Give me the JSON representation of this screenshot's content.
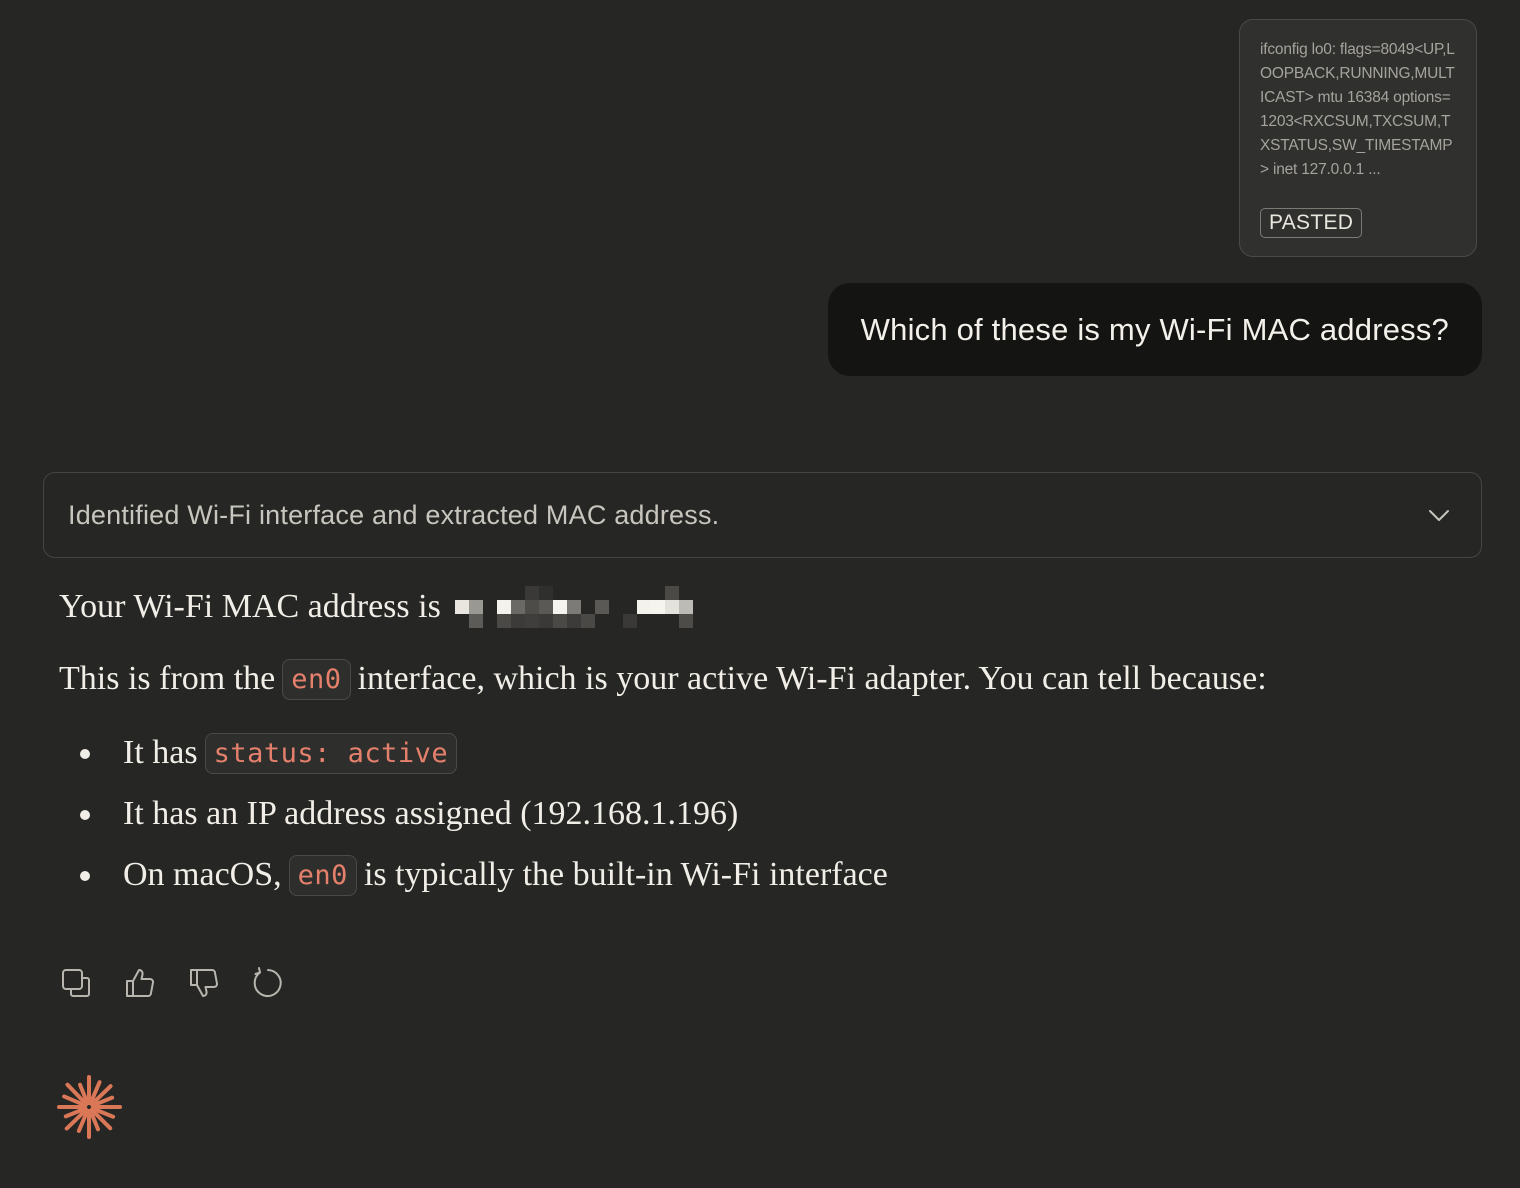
{
  "pasted": {
    "preview": "ifconfig lo0: flags=8049<UP,LOOPBACK,RUNNING,MULTICAST> mtu 16384 options=1203<RXCSUM,TXCSUM,TXSTATUS,SW_TIMESTAMP> inet 127.0.0.1 ...",
    "badge": "PASTED"
  },
  "user_message": "Which of these is my Wi-Fi MAC address?",
  "thinking": {
    "summary": "Identified Wi-Fi interface and extracted MAC address."
  },
  "answer": {
    "line1_prefix": "Your Wi-Fi MAC address is",
    "line2_before": "This is from the",
    "line2_code": "en0",
    "line2_after": "interface, which is your active Wi-Fi adapter. You can tell because:",
    "bullets": [
      {
        "before": "It has",
        "code": "status: active",
        "after": ""
      },
      {
        "before": "It has an IP address assigned (192.168.1.196)",
        "code": "",
        "after": ""
      },
      {
        "before": "On macOS,",
        "code": "en0",
        "after": "is typically the built-in Wi-Fi interface"
      }
    ]
  },
  "actions": {
    "icons": [
      "copy-icon",
      "thumbs-up-icon",
      "thumbs-down-icon",
      "retry-icon"
    ]
  },
  "colors": {
    "background": "#262624",
    "user_bubble": "#141413",
    "code_text": "#e5806c",
    "spark": "#d97757"
  }
}
